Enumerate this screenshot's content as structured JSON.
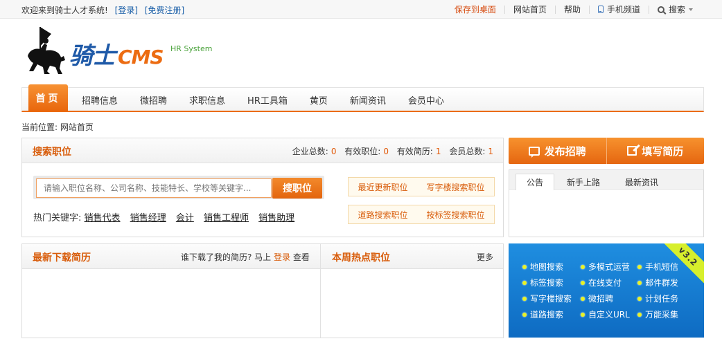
{
  "topbar": {
    "welcome": "欢迎来到骑士人才系统!",
    "login": "[登录]",
    "register": "[免费注册]",
    "links": [
      "保存到桌面",
      "网站首页",
      "帮助",
      "手机频道",
      "搜索"
    ]
  },
  "logo": {
    "brand": "骑士",
    "cms": "CMS",
    "tagline": "HR System"
  },
  "nav": {
    "home": "首页",
    "items": [
      "招聘信息",
      "微招聘",
      "求职信息",
      "HR工具箱",
      "黄页",
      "新闻资讯",
      "会员中心"
    ]
  },
  "breadcrumb": "当前位置: 网站首页",
  "search_panel": {
    "title": "搜索职位",
    "stats": [
      {
        "label": "企业总数:",
        "value": "0"
      },
      {
        "label": "有效职位:",
        "value": "0"
      },
      {
        "label": "有效简历:",
        "value": "1"
      },
      {
        "label": "会员总数:",
        "value": "1"
      }
    ],
    "placeholder": "请输入职位名称、公司名称、技能特长、学校等关键字...",
    "search_button": "搜职位",
    "hot_label": "热门关键字:",
    "hot_keywords": [
      "销售代表",
      "销售经理",
      "会计",
      "销售工程师",
      "销售助理"
    ],
    "quick_links": [
      "最近更新职位",
      "写字楼搜索职位",
      "道路搜索职位",
      "按标签搜索职位"
    ]
  },
  "actions": {
    "post_job": "发布招聘",
    "write_resume": "填写简历"
  },
  "notice": {
    "tabs": [
      "公告",
      "新手上路",
      "最新资讯"
    ]
  },
  "resume_panel": {
    "title": "最新下载简历",
    "prompt": "谁下载了我的简历? 马上",
    "login": "登录",
    "view": "查看",
    "hot_title": "本周热点职位",
    "more": "更多"
  },
  "features": {
    "version": "v3.2",
    "items": [
      "地图搜索",
      "多模式运营",
      "手机短信",
      "标签搜索",
      "在线支付",
      "邮件群发",
      "写字楼搜索",
      "微招聘",
      "计划任务",
      "道路搜索",
      "自定义URL",
      "万能采集"
    ]
  },
  "colors": {
    "accent": "#ec6c12",
    "brand_blue": "#1f5aa8",
    "feature_bg": "#1f8ee0"
  }
}
